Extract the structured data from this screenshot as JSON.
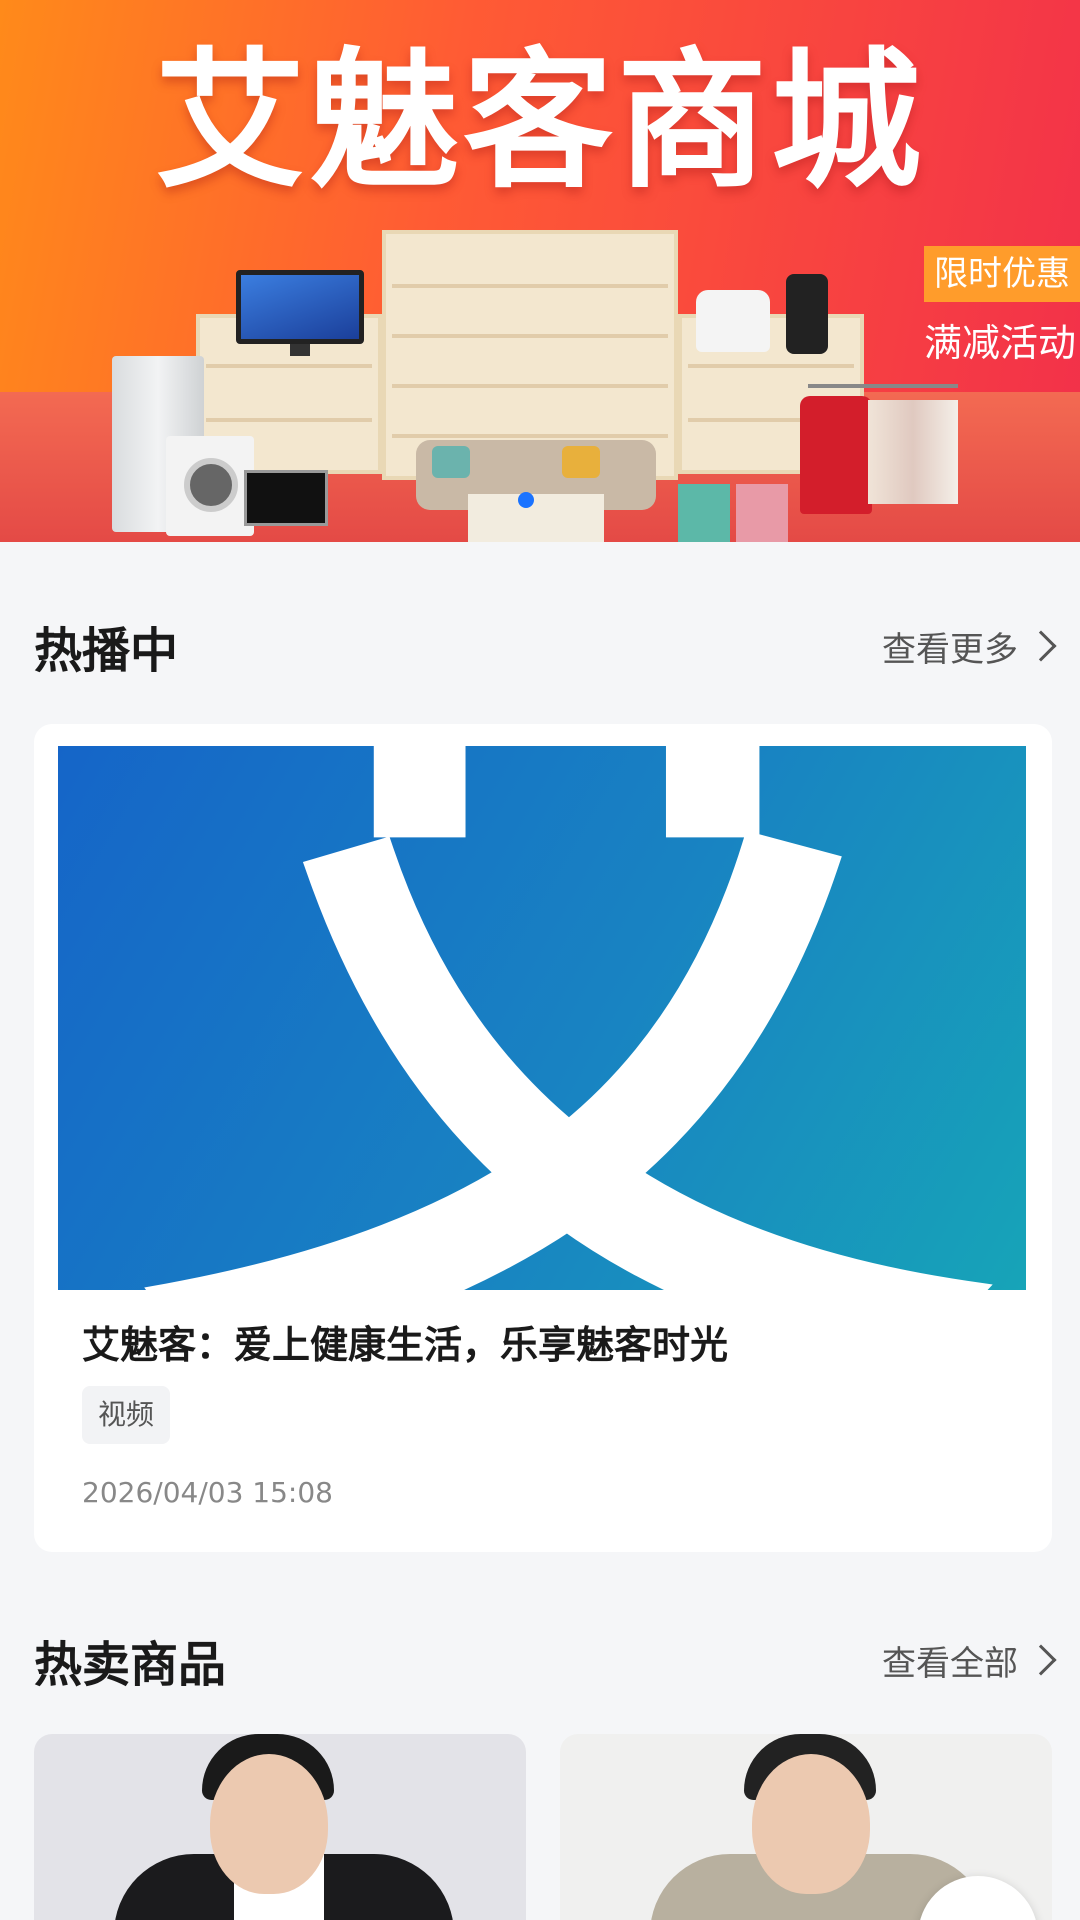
{
  "banner": {
    "title": "艾魅客商城",
    "promo_tag": "限时优惠",
    "promo_text": "满减活动"
  },
  "hot_section": {
    "title": "热播中",
    "more_label": "查看更多"
  },
  "video_card": {
    "cover_glyph": "艾",
    "title": "艾魅客：爱上健康生活，乐享魅客时光",
    "tag": "视频",
    "timestamp": "2026/04/03 15:08"
  },
  "products_section": {
    "title": "热卖商品",
    "more_label": "查看全部"
  },
  "colors": {
    "accent": "#1a73ff",
    "banner_orange": "#ff8a1a",
    "banner_red": "#f2304a"
  }
}
